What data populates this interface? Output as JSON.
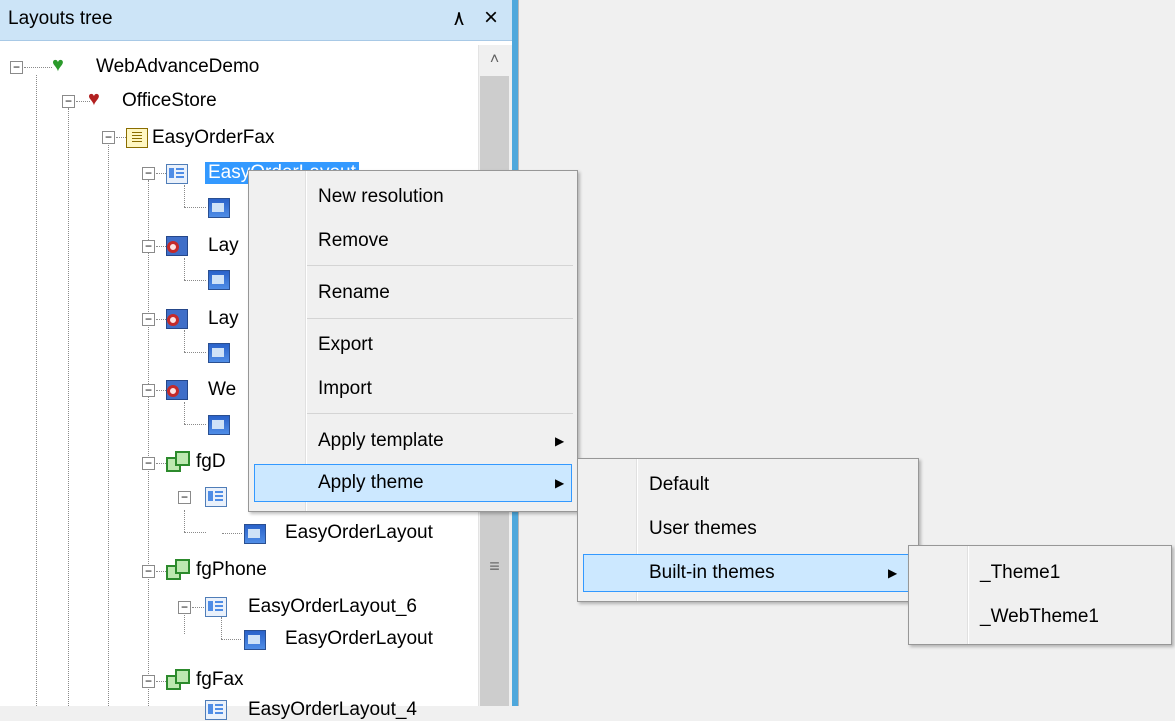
{
  "panel": {
    "title": "Layouts tree",
    "pin_glyph": "٨",
    "close_glyph": "×"
  },
  "scrollbar": {
    "up_glyph": "˄",
    "grip_glyph": "≡"
  },
  "tree": {
    "root": "WebAdvanceDemo",
    "store": "OfficeStore",
    "form": "EasyOrderFax",
    "selected": "EasyOrderLayout",
    "layout2": "Lay",
    "layout3": "Lay",
    "layout4": "We",
    "group_d": "fgD",
    "group_d_res": "EasyOrderLayout",
    "group_phone": "fgPhone",
    "phone_layout": "EasyOrderLayout_6",
    "phone_res": "EasyOrderLayout",
    "group_fax": "fgFax",
    "fax_layout": "EasyOrderLayout_4"
  },
  "context_menu": {
    "items": [
      "New resolution",
      "Remove",
      "Rename",
      "Export",
      "Import",
      "Apply template",
      "Apply theme"
    ],
    "arrow": "▶"
  },
  "theme_menu": {
    "items": [
      "Default",
      "User themes",
      "Built-in themes"
    ]
  },
  "builtin_menu": {
    "items": [
      "_Theme1",
      "_WebTheme1"
    ]
  }
}
